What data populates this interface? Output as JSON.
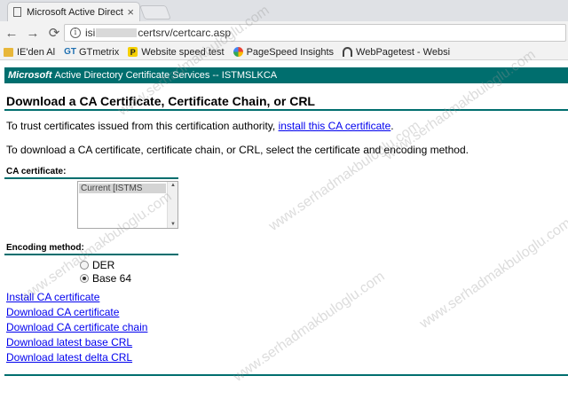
{
  "browser": {
    "tab_title": "Microsoft Active Director",
    "tab_close": "×",
    "nav": {
      "back": "←",
      "forward": "→",
      "reload": "⟳"
    },
    "info_icon": "i",
    "url_prefix": "isi",
    "url_suffix": "certsrv/certcarc.asp",
    "bookmarks": [
      {
        "icon": "folder-icon",
        "label": "IE'den Al"
      },
      {
        "icon": "gtmetrix-icon",
        "badge": "GT",
        "label": "GTmetrix"
      },
      {
        "icon": "website-speed-test-icon",
        "badge": "P",
        "label": "Website speed test"
      },
      {
        "icon": "pagespeed-icon",
        "label": "PageSpeed Insights"
      },
      {
        "icon": "webpagetest-icon",
        "label": "WebPagetest - Websi"
      }
    ]
  },
  "page": {
    "banner": {
      "brand": "Microsoft",
      "text": "Active Directory Certificate Services  --  ISTMSLKCA"
    },
    "title": "Download a CA Certificate, Certificate Chain, or CRL",
    "trust_text": "To trust certificates issued from this certification authority, ",
    "trust_link": "install this CA certificate",
    "trust_end": ".",
    "download_text": "To download a CA certificate, certificate chain, or CRL, select the certificate and encoding method.",
    "ca_label": "CA certificate:",
    "ca_option": "Current [ISTMS",
    "encoding_label": "Encoding method:",
    "encoding_options": [
      {
        "label": "DER",
        "selected": false
      },
      {
        "label": "Base 64",
        "selected": true
      }
    ],
    "links": [
      "Install CA certificate",
      "Download CA certificate",
      "Download CA certificate chain",
      "Download latest base CRL",
      "Download latest delta CRL"
    ]
  },
  "watermark": "www.serhadmakbuloglu.com",
  "colors": {
    "banner": "#006e6e",
    "link": "#0000ee"
  }
}
